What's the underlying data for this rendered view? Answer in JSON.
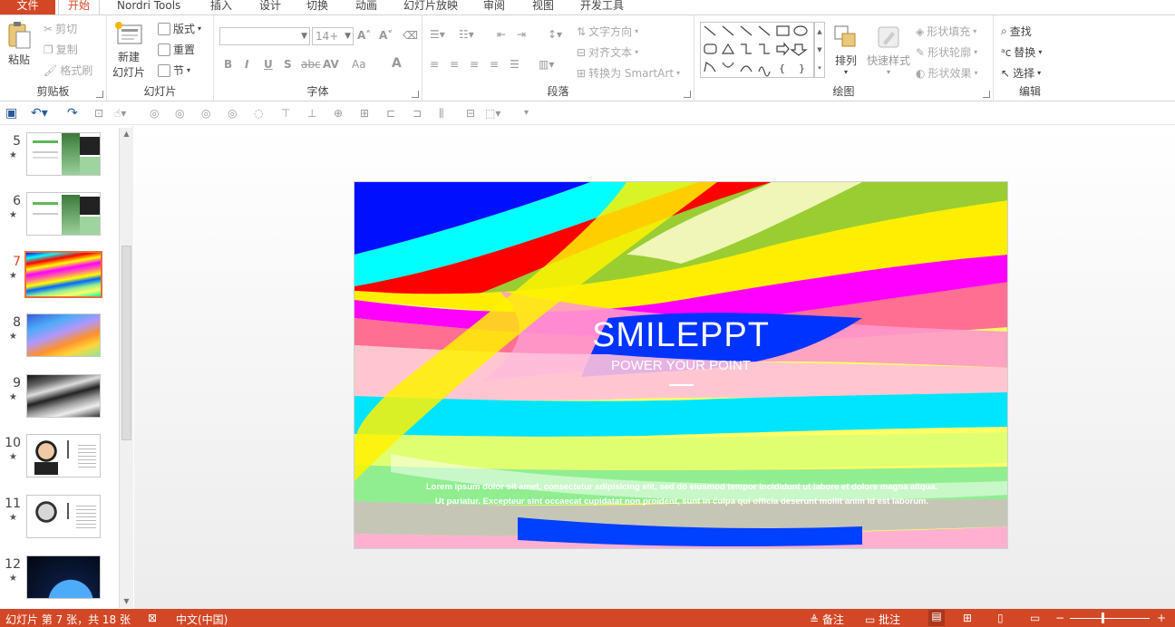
{
  "tabs": [
    {
      "label": "文件"
    },
    {
      "label": "开始"
    },
    {
      "label": "Nordri Tools"
    },
    {
      "label": "插入"
    },
    {
      "label": "设计"
    },
    {
      "label": "切换"
    },
    {
      "label": "动画"
    },
    {
      "label": "幻灯片放映"
    },
    {
      "label": "审阅"
    },
    {
      "label": "视图"
    },
    {
      "label": "开发工具"
    }
  ],
  "ribbon": {
    "clipboard": {
      "label": "剪贴板",
      "paste": "粘贴",
      "cut": "剪切",
      "copy": "复制",
      "format_painter": "格式刷"
    },
    "slides": {
      "label": "幻灯片",
      "new_slide": "新建",
      "new_slide2": "幻灯片",
      "layout": "版式",
      "reset": "重置",
      "section": "节"
    },
    "font": {
      "label": "字体",
      "font_name": "",
      "font_size": "14+",
      "bold": "B",
      "italic": "I",
      "underline": "U",
      "shadow": "S",
      "strike": "abc",
      "spacing": "AV",
      "case": "Aa",
      "color": "A"
    },
    "paragraph": {
      "label": "段落",
      "text_direction": "文字方向",
      "align_text": "对齐文本",
      "smartart": "转换为 SmartArt"
    },
    "drawing": {
      "label": "绘图",
      "arrange": "排列",
      "quick_styles": "快速样式",
      "shape_fill": "形状填充",
      "shape_outline": "形状轮廓",
      "shape_effects": "形状效果"
    },
    "editing": {
      "label": "编辑",
      "find": "查找",
      "replace": "替换",
      "select": "选择"
    }
  },
  "thumbnails": [
    {
      "num": "5",
      "star": "★"
    },
    {
      "num": "6",
      "star": "★"
    },
    {
      "num": "7",
      "star": "★"
    },
    {
      "num": "8",
      "star": "★"
    },
    {
      "num": "9",
      "star": "★"
    },
    {
      "num": "10",
      "star": "★"
    },
    {
      "num": "11",
      "star": "★"
    },
    {
      "num": "12",
      "star": "★"
    }
  ],
  "slide": {
    "title": "SMILEPPT",
    "subtitle": "POWER YOUR POINT",
    "body_line1": "Lorem ipsum dolor sit amet, consectetur adipisicing elit, sed do eiusmod tempor incididunt ut labore et dolore magna aliqua.",
    "body_line2": "Ut pariatur. Excepteur sint occaecat cupidatat non proident, sunt in culpa qui officia deserunt mollit anim id est laborum."
  },
  "status": {
    "slide_info": "幻灯片 第 7 张，共 18 张",
    "language": "中文(中国)",
    "notes": "备注",
    "comments": "批注"
  },
  "colors": {
    "accent": "#D24726",
    "selected_thumb": "#E8703A"
  }
}
